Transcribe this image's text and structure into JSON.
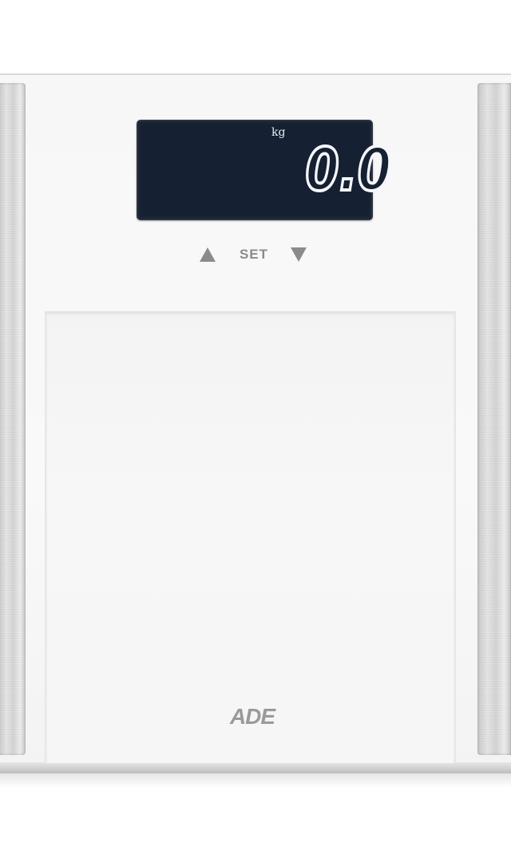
{
  "display": {
    "unit": "kg",
    "value": "0.0"
  },
  "controls": {
    "up_icon": "triangle-up-icon",
    "set_label": "SET",
    "down_icon": "triangle-down-icon"
  },
  "brand": {
    "logo_text": "ADE"
  },
  "colors": {
    "lcd_background": "#152032",
    "lcd_text": "#f4f6fa",
    "body": "#f7f7f7",
    "control_gray": "#8b8b8b"
  }
}
